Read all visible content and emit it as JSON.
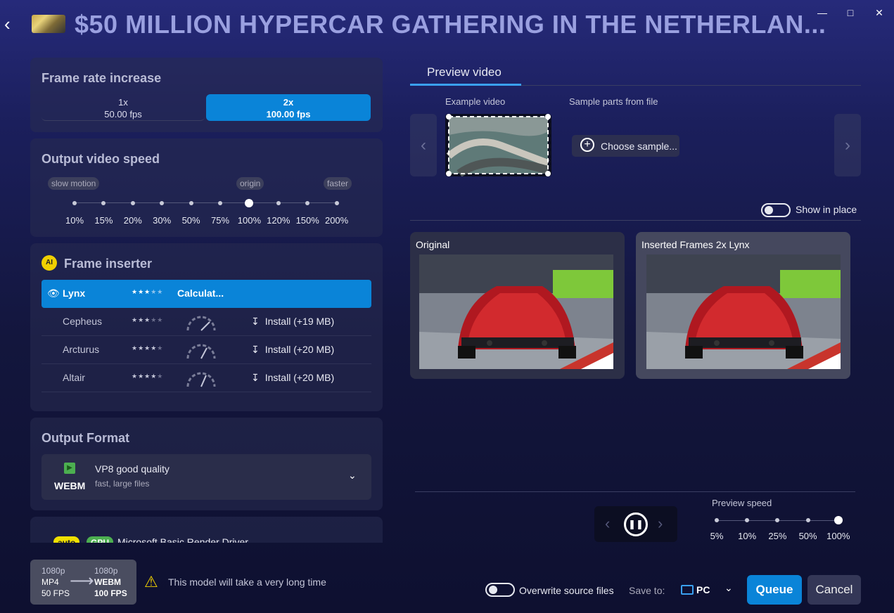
{
  "header": {
    "title": "$50 MILLION HYPERCAR GATHERING IN THE NETHERLAN...",
    "back_icon": "chevron-left-icon",
    "window_controls": [
      "minimize-icon",
      "maximize-icon",
      "close-icon"
    ]
  },
  "frame_rate": {
    "title": "Frame rate increase",
    "options": [
      {
        "multiplier": "1x",
        "fps": "50.00 fps",
        "selected": false
      },
      {
        "multiplier": "2x",
        "fps": "100.00 fps",
        "selected": true
      }
    ]
  },
  "output_speed": {
    "title": "Output video speed",
    "pills": {
      "slow": "slow motion",
      "origin": "origin",
      "fast": "faster"
    },
    "ticks": [
      "10%",
      "15%",
      "20%",
      "30%",
      "50%",
      "75%",
      "100%",
      "120%",
      "150%",
      "200%"
    ],
    "selected": "100%"
  },
  "frame_inserter": {
    "title": "Frame inserter",
    "badge": "AI",
    "models": [
      {
        "name": "Lynx",
        "stars": 3,
        "status": "Calculat...",
        "active": true
      },
      {
        "name": "Cepheus",
        "stars": 3.5,
        "action": "Install (+19 MB)"
      },
      {
        "name": "Arcturus",
        "stars": 4,
        "action": "Install (+20 MB)"
      },
      {
        "name": "Altair",
        "stars": 4.5,
        "action": "Install (+20 MB)"
      }
    ]
  },
  "output_format": {
    "title": "Output Format",
    "format": "WEBM",
    "quality": "VP8 good quality",
    "note": "fast, large files"
  },
  "render": {
    "auto_badge": "auto",
    "gpu_badge": "GPU",
    "driver": "Microsoft Basic Render Driver"
  },
  "summary": {
    "from_res": "1080p",
    "from_fmt": "MP4",
    "from_fps": "50 FPS",
    "to_res": "1080p",
    "to_fmt": "WEBM",
    "to_fps": "100 FPS",
    "warning": "This model will take a very long time"
  },
  "preview": {
    "tab": "Preview video",
    "example_label": "Example video",
    "sample_label": "Sample parts from file",
    "choose_sample": "Choose sample...",
    "show_in_place": "Show in place",
    "original_label": "Original",
    "inserted_label": "Inserted Frames 2x Lynx",
    "speed_label": "Preview speed",
    "speed_ticks": [
      "5%",
      "10%",
      "25%",
      "50%",
      "100%"
    ],
    "speed_selected": "100%"
  },
  "bottom": {
    "overwrite": "Overwrite source files",
    "save_to": "Save to:",
    "target": "PC",
    "queue": "Queue",
    "cancel": "Cancel"
  }
}
